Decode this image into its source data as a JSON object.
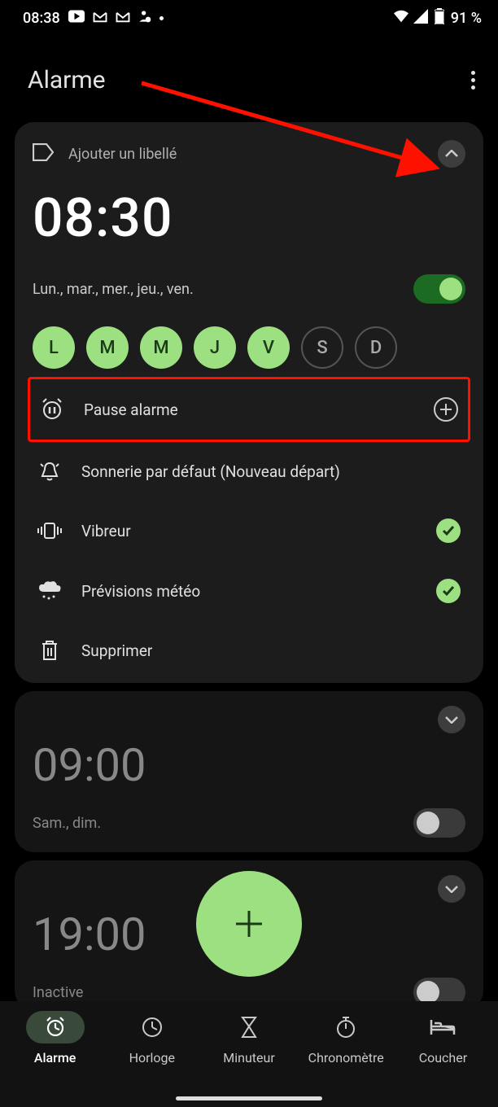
{
  "status": {
    "time": "08:38",
    "battery": "91 %"
  },
  "header": {
    "title": "Alarme"
  },
  "alarm1": {
    "label_placeholder": "Ajouter un libellé",
    "time": "08:30",
    "days_summary": "Lun., mar., mer., jeu., ven.",
    "weekdays": [
      "L",
      "M",
      "M",
      "J",
      "V",
      "S",
      "D"
    ],
    "pause": "Pause alarme",
    "ringtone": "Sonnerie par défaut (Nouveau départ)",
    "vibrate": "Vibreur",
    "weather": "Prévisions météo",
    "delete": "Supprimer"
  },
  "alarm2": {
    "time": "09:00",
    "days_summary": "Sam., dim."
  },
  "alarm3": {
    "time": "19:00",
    "status": "Inactive"
  },
  "nav": {
    "alarm": "Alarme",
    "clock": "Horloge",
    "timer": "Minuteur",
    "stopwatch": "Chronomètre",
    "bedtime": "Coucher"
  }
}
